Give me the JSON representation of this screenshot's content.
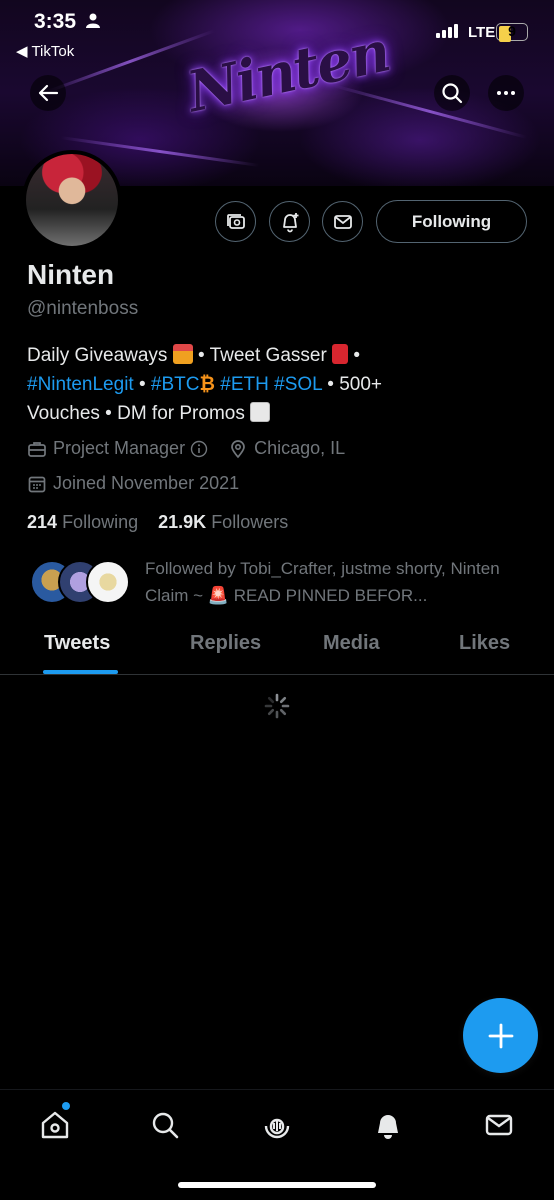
{
  "status_bar": {
    "time": "3:35",
    "back_app": "TikTok",
    "network": "LTE",
    "battery": "9"
  },
  "profile": {
    "display_name": "Ninten",
    "handle": "@nintenboss",
    "follow_button_label": "Following",
    "banner_text": "Ninten"
  },
  "bio": {
    "line1_text1": "Daily Giveaways ",
    "line1_text2": " • Tweet Gasser ",
    "line1_text3": " •",
    "hashtag_ninten": "#NintenLegit",
    "sep1": " • ",
    "hashtag_btc": "#BTC",
    "hashtag_eth": " #ETH",
    "hashtag_sol": " #SOL",
    "line2_tail": " • 500+",
    "line3": "Vouches • DM for Promos "
  },
  "meta": {
    "job": "Project Manager",
    "location": "Chicago, IL",
    "joined": "Joined November 2021"
  },
  "counts": {
    "following_count": "214",
    "following_label": "Following",
    "followers_count": "21.9K",
    "followers_label": "Followers"
  },
  "followed_by": "Followed by Tobi_Crafter, justme shorty, Ninten Claim ~ 🚨 READ PINNED BEFOR...",
  "tabs": [
    {
      "label": "Tweets"
    },
    {
      "label": "Replies"
    },
    {
      "label": "Media"
    },
    {
      "label": "Likes"
    }
  ],
  "colors": {
    "accent": "#1d9bf0",
    "background": "#000000",
    "secondary_text": "#71767b"
  },
  "icons": {
    "back": "arrow-left-icon",
    "search": "search-icon",
    "more": "more-horizontal-icon",
    "subscriptions": "subscriptions-icon",
    "notify": "bell-plus-icon",
    "message": "envelope-icon",
    "job": "briefcase-icon",
    "location": "location-pin-icon",
    "joined": "calendar-icon",
    "compose": "plus-icon"
  },
  "bottom_nav": [
    "home-icon",
    "search-icon",
    "spaces-icon",
    "bell-icon",
    "mail-icon"
  ]
}
